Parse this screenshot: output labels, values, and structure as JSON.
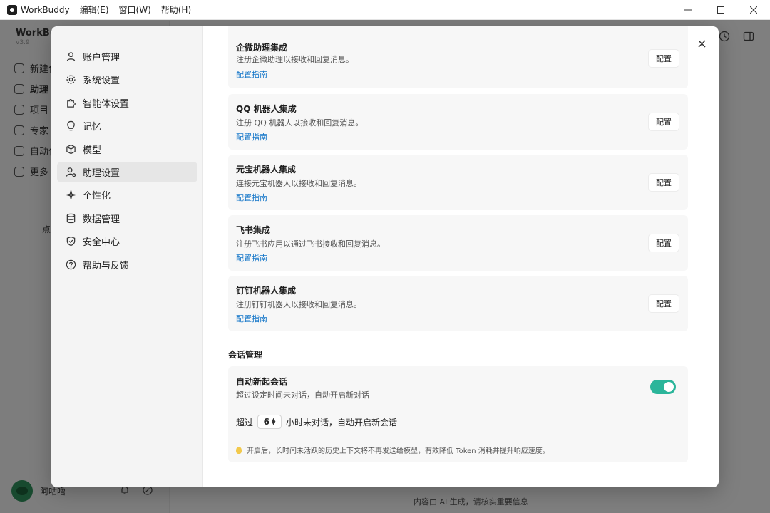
{
  "titlebar": {
    "app_name": "WorkBuddy",
    "menu": [
      "编辑(E)",
      "窗口(W)",
      "帮助(H)"
    ]
  },
  "background": {
    "brand": "WorkBu",
    "brand_sub": "v3.9",
    "nav": [
      "新建任",
      "助理",
      "项目",
      "专家",
      "自动化",
      "更多"
    ],
    "hint": "点",
    "username": "阿咕噜",
    "footer": "内容由 AI 生成，请核实重要信息"
  },
  "sidebar": {
    "items": [
      {
        "label": "账户管理",
        "icon": "user-icon"
      },
      {
        "label": "系统设置",
        "icon": "gear-icon"
      },
      {
        "label": "智能体设置",
        "icon": "puzzle-icon"
      },
      {
        "label": "记忆",
        "icon": "memory-icon"
      },
      {
        "label": "模型",
        "icon": "cube-icon"
      },
      {
        "label": "助理设置",
        "icon": "assistant-icon"
      },
      {
        "label": "个性化",
        "icon": "sparkle-icon"
      },
      {
        "label": "数据管理",
        "icon": "database-icon"
      },
      {
        "label": "安全中心",
        "icon": "shield-icon"
      },
      {
        "label": "帮助与反馈",
        "icon": "help-icon"
      }
    ],
    "active_index": 5
  },
  "integrations": [
    {
      "title": "企微助理集成",
      "desc": "注册企微助理以接收和回复消息。",
      "link": "配置指南",
      "button": "配置"
    },
    {
      "title": "QQ 机器人集成",
      "desc": "注册 QQ 机器人以接收和回复消息。",
      "link": "配置指南",
      "button": "配置"
    },
    {
      "title": "元宝机器人集成",
      "desc": "连接元宝机器人以接收和回复消息。",
      "link": "配置指南",
      "button": "配置"
    },
    {
      "title": "飞书集成",
      "desc": "注册飞书应用以通过飞书接收和回复消息。",
      "link": "配置指南",
      "button": "配置"
    },
    {
      "title": "钉钉机器人集成",
      "desc": "注册钉钉机器人以接收和回复消息。",
      "link": "配置指南",
      "button": "配置"
    }
  ],
  "session": {
    "section_title": "会话管理",
    "auto_title": "自动新起会话",
    "auto_desc": "超过设定时间未对话，自动开启新对话",
    "auto_enabled": true,
    "prefix": "超过",
    "hours": "6",
    "suffix": "小时未对话，自动开启新会话",
    "tip": "开启后，长时间未活跃的历史上下文将不再发送给模型，有效降低 Token 消耗并提升响应速度。"
  },
  "colors": {
    "accent": "#2bb59a",
    "link": "#1677c9"
  }
}
